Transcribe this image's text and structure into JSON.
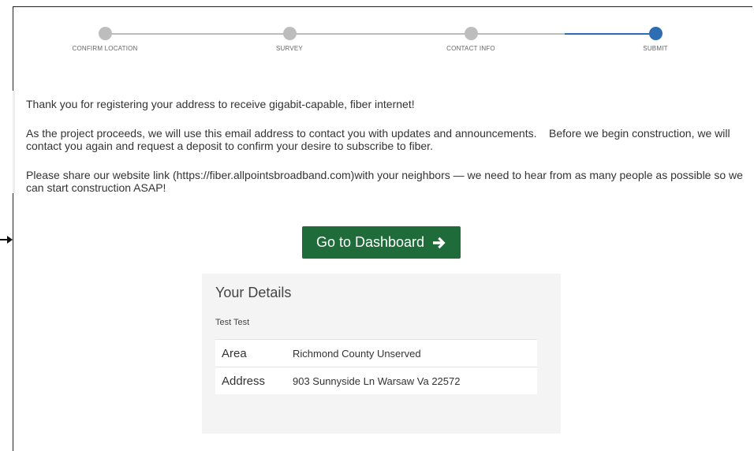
{
  "stepper": {
    "steps": [
      {
        "label": "CONFIRM LOCATION",
        "active": false
      },
      {
        "label": "SURVEY",
        "active": false
      },
      {
        "label": "CONTACT INFO",
        "active": false
      },
      {
        "label": "SUBMIT",
        "active": true
      }
    ],
    "colors": {
      "inactive": "#bdbdbd",
      "active": "#2f6db3"
    }
  },
  "messages": {
    "thanks": "Thank you for registering your address to receive gigabit-capable, fiber internet!",
    "updates": "As the project proceeds, we will use this email address to contact you with updates and announcements.    Before we begin construction, we will contact you again and request a deposit to confirm your desire to subscribe to fiber.",
    "share": "Please share our website link (https://fiber.allpointsbroadband.com)with your neighbors — we need to hear from as many people as possible so we can start construction ASAP!"
  },
  "dashboard_button": {
    "label": "Go to Dashboard",
    "icon": "arrow-right-icon",
    "color": "#1f6b3a"
  },
  "details": {
    "title": "Your Details",
    "name": "Test Test",
    "rows": [
      {
        "key": "Area",
        "value": "Richmond County Unserved"
      },
      {
        "key": "Address",
        "value": "903 Sunnyside Ln Warsaw Va 22572"
      }
    ]
  }
}
